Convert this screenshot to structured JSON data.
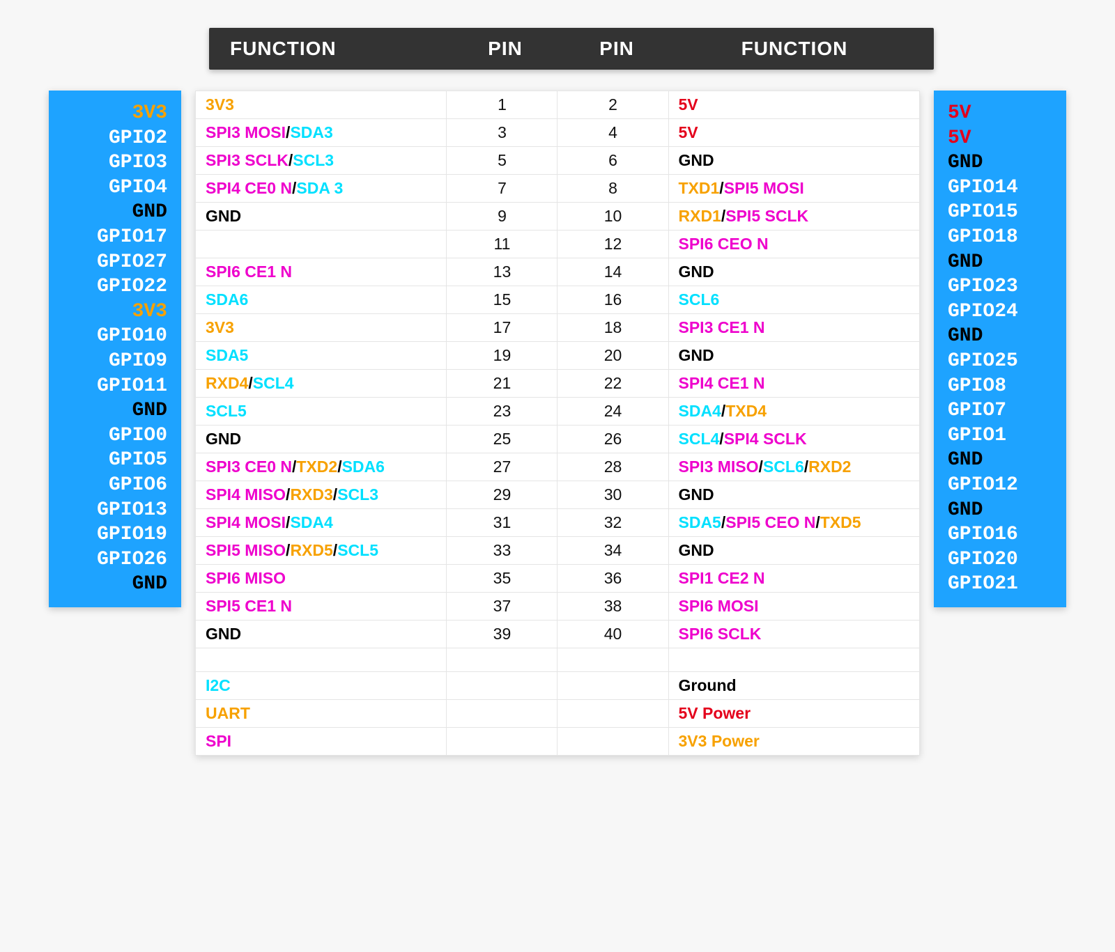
{
  "header": {
    "f1": "FUNCTION",
    "p1": "PIN",
    "p2": "PIN",
    "f2": "FUNCTION"
  },
  "colors": {
    "i2c": "cyan",
    "uart": "orange",
    "spi": "magenta",
    "ground": "black",
    "5v": "red",
    "3v3": "orange",
    "gpio": "white"
  },
  "left_sidebar": [
    {
      "t": "3V3",
      "c": "orange"
    },
    {
      "t": "GPIO2",
      "c": "white"
    },
    {
      "t": "GPIO3",
      "c": "white"
    },
    {
      "t": "GPIO4",
      "c": "white"
    },
    {
      "t": "GND",
      "c": "black"
    },
    {
      "t": "GPIO17",
      "c": "white"
    },
    {
      "t": "GPIO27",
      "c": "white"
    },
    {
      "t": "GPIO22",
      "c": "white"
    },
    {
      "t": "3V3",
      "c": "orange"
    },
    {
      "t": "GPIO10",
      "c": "white"
    },
    {
      "t": "GPIO9",
      "c": "white"
    },
    {
      "t": "GPIO11",
      "c": "white"
    },
    {
      "t": "GND",
      "c": "black"
    },
    {
      "t": "GPIO0",
      "c": "white"
    },
    {
      "t": "GPIO5",
      "c": "white"
    },
    {
      "t": "GPIO6",
      "c": "white"
    },
    {
      "t": "GPIO13",
      "c": "white"
    },
    {
      "t": "GPIO19",
      "c": "white"
    },
    {
      "t": "GPIO26",
      "c": "white"
    },
    {
      "t": "GND",
      "c": "black"
    }
  ],
  "right_sidebar": [
    {
      "t": "5V",
      "c": "red"
    },
    {
      "t": "5V",
      "c": "red"
    },
    {
      "t": "GND",
      "c": "black"
    },
    {
      "t": "GPIO14",
      "c": "white"
    },
    {
      "t": "GPIO15",
      "c": "white"
    },
    {
      "t": "GPIO18",
      "c": "white"
    },
    {
      "t": "GND",
      "c": "black"
    },
    {
      "t": "GPIO23",
      "c": "white"
    },
    {
      "t": "GPIO24",
      "c": "white"
    },
    {
      "t": "GND",
      "c": "black"
    },
    {
      "t": "GPIO25",
      "c": "white"
    },
    {
      "t": "GPIO8",
      "c": "white"
    },
    {
      "t": "GPIO7",
      "c": "white"
    },
    {
      "t": "GPIO1",
      "c": "white"
    },
    {
      "t": "GND",
      "c": "black"
    },
    {
      "t": "GPIO12",
      "c": "white"
    },
    {
      "t": "GND",
      "c": "black"
    },
    {
      "t": "GPIO16",
      "c": "white"
    },
    {
      "t": "GPIO20",
      "c": "white"
    },
    {
      "t": "GPIO21",
      "c": "white"
    }
  ],
  "rows": [
    {
      "pinL": "1",
      "pinR": "2",
      "funcL": [
        {
          "t": "3V3",
          "c": "orange"
        }
      ],
      "funcR": [
        {
          "t": "5V",
          "c": "red"
        }
      ]
    },
    {
      "pinL": "3",
      "pinR": "4",
      "funcL": [
        {
          "t": "SPI3 MOSI",
          "c": "magenta"
        },
        {
          "t": "SDA3",
          "c": "cyan"
        }
      ],
      "funcR": [
        {
          "t": "5V",
          "c": "red"
        }
      ]
    },
    {
      "pinL": "5",
      "pinR": "6",
      "funcL": [
        {
          "t": "SPI3 SCLK",
          "c": "magenta"
        },
        {
          "t": "SCL3",
          "c": "cyan"
        }
      ],
      "funcR": [
        {
          "t": "GND",
          "c": "black"
        }
      ]
    },
    {
      "pinL": "7",
      "pinR": "8",
      "funcL": [
        {
          "t": "SPI4 CE0 N",
          "c": "magenta"
        },
        {
          "t": "SDA 3",
          "c": "cyan"
        }
      ],
      "funcR": [
        {
          "t": "TXD1",
          "c": "orange"
        },
        {
          "t": "SPI5 MOSI",
          "c": "magenta"
        }
      ]
    },
    {
      "pinL": "9",
      "pinR": "10",
      "funcL": [
        {
          "t": "GND",
          "c": "black"
        }
      ],
      "funcR": [
        {
          "t": "RXD1",
          "c": "orange"
        },
        {
          "t": "SPI5 SCLK",
          "c": "magenta"
        }
      ]
    },
    {
      "pinL": "11",
      "pinR": "12",
      "funcL": [],
      "funcR": [
        {
          "t": "SPI6 CEO N",
          "c": "magenta"
        }
      ]
    },
    {
      "pinL": "13",
      "pinR": "14",
      "funcL": [
        {
          "t": "SPI6 CE1 N",
          "c": "magenta"
        }
      ],
      "funcR": [
        {
          "t": "GND",
          "c": "black"
        }
      ]
    },
    {
      "pinL": "15",
      "pinR": "16",
      "funcL": [
        {
          "t": "SDA6",
          "c": "cyan"
        }
      ],
      "funcR": [
        {
          "t": "SCL6",
          "c": "cyan"
        }
      ]
    },
    {
      "pinL": "17",
      "pinR": "18",
      "funcL": [
        {
          "t": "3V3",
          "c": "orange"
        }
      ],
      "funcR": [
        {
          "t": "SPI3 CE1 N",
          "c": "magenta"
        }
      ]
    },
    {
      "pinL": "19",
      "pinR": "20",
      "funcL": [
        {
          "t": "SDA5",
          "c": "cyan"
        }
      ],
      "funcR": [
        {
          "t": "GND",
          "c": "black"
        }
      ]
    },
    {
      "pinL": "21",
      "pinR": "22",
      "funcL": [
        {
          "t": "RXD4",
          "c": "orange"
        },
        {
          "t": "SCL4",
          "c": "cyan"
        }
      ],
      "funcR": [
        {
          "t": "SPI4 CE1 N",
          "c": "magenta"
        }
      ]
    },
    {
      "pinL": "23",
      "pinR": "24",
      "funcL": [
        {
          "t": "SCL5",
          "c": "cyan"
        }
      ],
      "funcR": [
        {
          "t": "SDA4",
          "c": "cyan"
        },
        {
          "t": "TXD4",
          "c": "orange"
        }
      ]
    },
    {
      "pinL": "25",
      "pinR": "26",
      "funcL": [
        {
          "t": "GND",
          "c": "black"
        }
      ],
      "funcR": [
        {
          "t": "SCL4",
          "c": "cyan"
        },
        {
          "t": "SPI4 SCLK",
          "c": "magenta"
        }
      ]
    },
    {
      "pinL": "27",
      "pinR": "28",
      "funcL": [
        {
          "t": "SPI3 CE0 N",
          "c": "magenta"
        },
        {
          "t": "TXD2",
          "c": "orange"
        },
        {
          "t": "SDA6",
          "c": "cyan"
        }
      ],
      "funcR": [
        {
          "t": "SPI3 MISO",
          "c": "magenta"
        },
        {
          "t": "SCL6",
          "c": "cyan"
        },
        {
          "t": "RXD2",
          "c": "orange"
        }
      ]
    },
    {
      "pinL": "29",
      "pinR": "30",
      "funcL": [
        {
          "t": "SPI4 MISO",
          "c": "magenta"
        },
        {
          "t": "RXD3",
          "c": "orange"
        },
        {
          "t": "SCL3",
          "c": "cyan"
        }
      ],
      "funcR": [
        {
          "t": "GND",
          "c": "black"
        }
      ]
    },
    {
      "pinL": "31",
      "pinR": "32",
      "funcL": [
        {
          "t": "SPI4 MOSI",
          "c": "magenta"
        },
        {
          "t": "SDA4",
          "c": "cyan"
        }
      ],
      "funcR": [
        {
          "t": "SDA5",
          "c": "cyan"
        },
        {
          "t": "SPI5 CEO N",
          "c": "magenta"
        },
        {
          "t": "TXD5",
          "c": "orange"
        }
      ]
    },
    {
      "pinL": "33",
      "pinR": "34",
      "funcL": [
        {
          "t": "SPI5 MISO",
          "c": "magenta"
        },
        {
          "t": "RXD5",
          "c": "orange"
        },
        {
          "t": "SCL5",
          "c": "cyan"
        }
      ],
      "funcR": [
        {
          "t": "GND",
          "c": "black"
        }
      ]
    },
    {
      "pinL": "35",
      "pinR": "36",
      "funcL": [
        {
          "t": "SPI6 MISO",
          "c": "magenta"
        }
      ],
      "funcR": [
        {
          "t": "SPI1 CE2 N",
          "c": "magenta"
        }
      ]
    },
    {
      "pinL": "37",
      "pinR": "38",
      "funcL": [
        {
          "t": "SPI5 CE1 N",
          "c": "magenta"
        }
      ],
      "funcR": [
        {
          "t": "SPI6 MOSI",
          "c": "magenta"
        }
      ]
    },
    {
      "pinL": "39",
      "pinR": "40",
      "funcL": [
        {
          "t": "GND",
          "c": "black"
        }
      ],
      "funcR": [
        {
          "t": "SPI6 SCLK",
          "c": "magenta"
        }
      ]
    }
  ],
  "legend": [
    {
      "l": [
        {
          "t": "I2C",
          "c": "cyan"
        }
      ],
      "r": [
        {
          "t": "Ground",
          "c": "black"
        }
      ]
    },
    {
      "l": [
        {
          "t": "UART",
          "c": "orange"
        }
      ],
      "r": [
        {
          "t": "5V Power",
          "c": "red"
        }
      ]
    },
    {
      "l": [
        {
          "t": "SPI",
          "c": "magenta"
        }
      ],
      "r": [
        {
          "t": "3V3 Power",
          "c": "orange"
        }
      ]
    }
  ]
}
